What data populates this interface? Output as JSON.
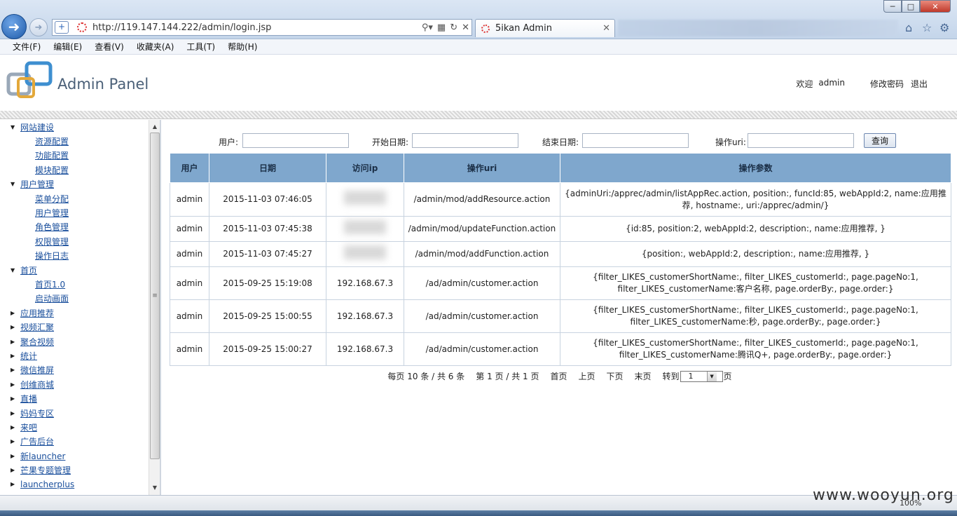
{
  "browser": {
    "url": "http://119.147.144.222/admin/login.jsp",
    "tab_title": "5ikan Admin",
    "menu": [
      "文件(F)",
      "编辑(E)",
      "查看(V)",
      "收藏夹(A)",
      "工具(T)",
      "帮助(H)"
    ],
    "zoom": "100%"
  },
  "header": {
    "title": "Admin Panel",
    "welcome": "欢迎",
    "user": "admin",
    "change_password": "修改密码",
    "logout": "退出"
  },
  "sidebar": {
    "items": [
      {
        "label": "网站建设",
        "expanded": true,
        "children": [
          "资源配置",
          "功能配置",
          "模块配置"
        ]
      },
      {
        "label": "用户管理",
        "expanded": true,
        "children": [
          "菜单分配",
          "用户管理",
          "角色管理",
          "权限管理",
          "操作日志"
        ]
      },
      {
        "label": "首页",
        "expanded": true,
        "children": [
          "首页1.0",
          "启动画面"
        ]
      },
      {
        "label": "应用推荐",
        "expanded": false,
        "children": []
      },
      {
        "label": "视频汇聚",
        "expanded": false,
        "children": []
      },
      {
        "label": "聚合视频",
        "expanded": false,
        "children": []
      },
      {
        "label": "统计",
        "expanded": false,
        "children": []
      },
      {
        "label": "微信推屏",
        "expanded": false,
        "children": []
      },
      {
        "label": "创维商城",
        "expanded": false,
        "children": []
      },
      {
        "label": "直播",
        "expanded": false,
        "children": []
      },
      {
        "label": "妈妈专区",
        "expanded": false,
        "children": []
      },
      {
        "label": "来吧",
        "expanded": false,
        "children": []
      },
      {
        "label": "广告后台",
        "expanded": false,
        "children": []
      },
      {
        "label": "新launcher",
        "expanded": false,
        "children": []
      },
      {
        "label": "芒果专题管理",
        "expanded": false,
        "children": []
      },
      {
        "label": "launcherplus",
        "expanded": false,
        "children": []
      }
    ]
  },
  "search": {
    "user_label": "用户:",
    "start_label": "开始日期:",
    "end_label": "结束日期:",
    "uri_label": "操作uri:",
    "user_value": "",
    "start_value": "",
    "end_value": "",
    "uri_value": "",
    "button": "查询"
  },
  "table": {
    "headers": [
      "用户",
      "日期",
      "访问ip",
      "操作uri",
      "操作参数"
    ],
    "rows": [
      [
        "admin",
        "2015-11-03 07:46:05",
        "",
        "/admin/mod/addResource.action",
        "{adminUri:/apprec/admin/listAppRec.action, position:, funcId:85, webAppId:2, name:应用推荐, hostname:, uri:/apprec/admin/}"
      ],
      [
        "admin",
        "2015-11-03 07:45:38",
        "",
        "/admin/mod/updateFunction.action",
        "{id:85, position:2, webAppId:2, description:, name:应用推荐, }"
      ],
      [
        "admin",
        "2015-11-03 07:45:27",
        "",
        "/admin/mod/addFunction.action",
        "{position:, webAppId:2, description:, name:应用推荐, }"
      ],
      [
        "admin",
        "2015-09-25 15:19:08",
        "192.168.67.3",
        "/ad/admin/customer.action",
        "{filter_LIKES_customerShortName:, filter_LIKES_customerId:, page.pageNo:1, filter_LIKES_customerName:客户名称, page.orderBy:, page.order:}"
      ],
      [
        "admin",
        "2015-09-25 15:00:55",
        "192.168.67.3",
        "/ad/admin/customer.action",
        "{filter_LIKES_customerShortName:, filter_LIKES_customerId:, page.pageNo:1, filter_LIKES_customerName:秒, page.orderBy:, page.order:}"
      ],
      [
        "admin",
        "2015-09-25 15:00:27",
        "192.168.67.3",
        "/ad/admin/customer.action",
        "{filter_LIKES_customerShortName:, filter_LIKES_customerId:, page.pageNo:1, filter_LIKES_customerName:腾讯Q+, page.orderBy:, page.order:}"
      ]
    ]
  },
  "pager": {
    "per_page": "每页 10 条 / 共 6 条",
    "page_info": "第 1 页 / 共 1 页",
    "first": "首页",
    "prev": "上页",
    "next": "下页",
    "last": "末页",
    "goto": "转到",
    "page_value": "1",
    "page_suffix": "页"
  },
  "watermark": "www.wooyun.org",
  "colors": {
    "table_header": "#7fa7cd",
    "link": "#1a4f9c",
    "title": "#4b6078"
  }
}
